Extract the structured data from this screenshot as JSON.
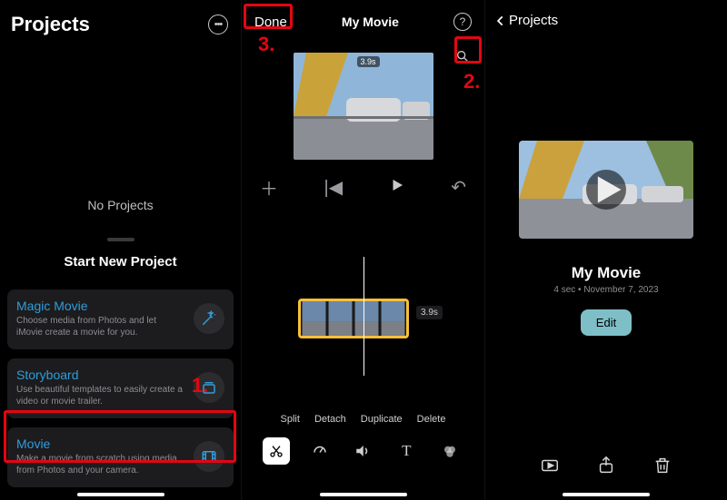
{
  "panel1": {
    "title": "Projects",
    "no_projects": "No Projects",
    "start_new": "Start New Project",
    "cards": [
      {
        "title": "Magic Movie",
        "desc": "Choose media from Photos and let iMovie create a movie for you.",
        "icon": "wand-icon"
      },
      {
        "title": "Storyboard",
        "desc": "Use beautiful templates to easily create a video or movie trailer.",
        "icon": "storyboard-icon"
      },
      {
        "title": "Movie",
        "desc": "Make a movie from scratch using media from Photos and your camera.",
        "icon": "film-icon"
      }
    ],
    "annotations": {
      "one": "1.",
      "three": "3."
    }
  },
  "panel2": {
    "done": "Done",
    "title": "My Movie",
    "preview_duration": "3.9s",
    "clip_duration": "3.9s",
    "actions": {
      "split": "Split",
      "detach": "Detach",
      "duplicate": "Duplicate",
      "delete": "Delete"
    },
    "annotations": {
      "two": "2."
    }
  },
  "panel3": {
    "back": "Projects",
    "movie_name": "My Movie",
    "meta": "4 sec • November 7, 2023",
    "edit": "Edit"
  }
}
